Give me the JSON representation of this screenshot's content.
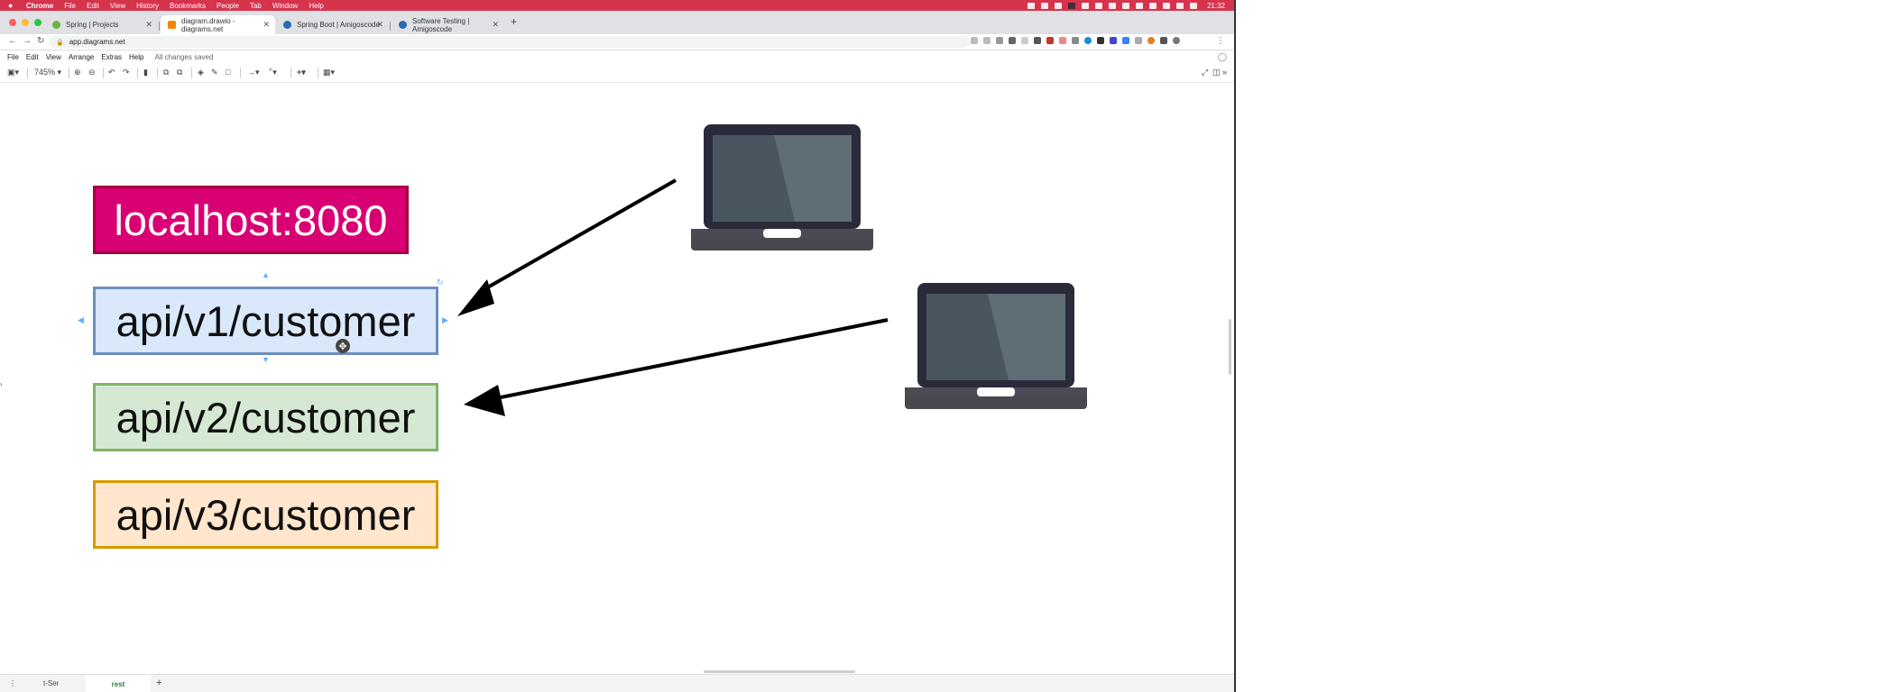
{
  "menubar": {
    "apple_icon": "apple-icon",
    "app_name": "Chrome",
    "items": [
      "File",
      "Edit",
      "View",
      "History",
      "Bookmarks",
      "People",
      "Tab",
      "Window",
      "Help"
    ],
    "clock": "21:32"
  },
  "tabs": [
    {
      "title": "Spring | Projects",
      "favicon_color": "#6db33f",
      "active": false
    },
    {
      "title": "diagram.drawio - diagrams.net",
      "favicon_color": "#f08705",
      "active": true
    },
    {
      "title": "Spring Boot | Amigoscode",
      "favicon_color": "#2b6cb0",
      "active": false
    },
    {
      "title": "Software Testing | Amigoscode",
      "favicon_color": "#2b6cb0",
      "active": false
    }
  ],
  "address": {
    "url": "app.diagrams.net"
  },
  "app_menu": {
    "items": [
      "File",
      "Edit",
      "View",
      "Arrange",
      "Extras",
      "Help"
    ],
    "status": "All changes saved"
  },
  "toolbar": {
    "zoom": "745%"
  },
  "diagram": {
    "host_label": "localhost:8080",
    "v1_label": "api/v1/customer",
    "v2_label": "api/v2/customer",
    "v3_label": "api/v3/customer",
    "colors": {
      "host_fill": "#d80073",
      "v1_fill": "#dae8fc",
      "v2_fill": "#d5e8d4",
      "v3_fill": "#ffe6cc",
      "laptop_body": "#2a2a3a",
      "laptop_screen": "#4a565f"
    }
  },
  "pages": {
    "first": "t-Ser",
    "current": "rest",
    "add": "+"
  }
}
